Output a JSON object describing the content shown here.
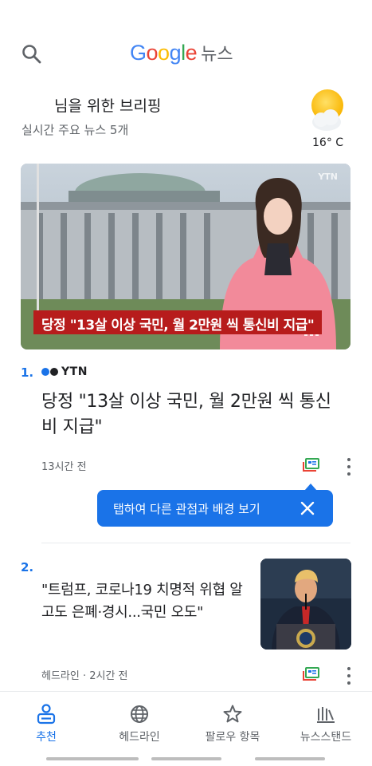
{
  "header": {
    "logo_letters": [
      {
        "char": "G",
        "color": "#4285F4"
      },
      {
        "char": "o",
        "color": "#EA4335"
      },
      {
        "char": "o",
        "color": "#FBBC05"
      },
      {
        "char": "g",
        "color": "#4285F4"
      },
      {
        "char": "l",
        "color": "#34A853"
      },
      {
        "char": "e",
        "color": "#EA4335"
      }
    ],
    "logo_suffix": "뉴스",
    "search_icon": "search-icon"
  },
  "briefing": {
    "title": "님을 위한 브리핑",
    "subtitle": "실시간 주요 뉴스 5개"
  },
  "weather": {
    "icon": "partly-cloudy-icon",
    "temperature": "16° C"
  },
  "articles": [
    {
      "number": "1.",
      "source": "YTN",
      "source_dot_colors": [
        "#1a73e8",
        "#202124"
      ],
      "image_caption": "당정 \"13살 이상 국민, 월 2만원 씩 통신비 지급\"",
      "image_watermark": "YTN",
      "headline": "당정 \"13살 이상 국민, 월 2만원 씩 통신비 지급\"",
      "time": "13시간 전"
    },
    {
      "number": "2.",
      "headline": "\"트럼프, 코로나19 치명적 위협 알고도 은폐·경시...국민 오도\"",
      "meta": "헤드라인 · 2시간 전"
    }
  ],
  "tooltip": {
    "text": "탭하여 다른 관점과 배경 보기",
    "close_icon": "close-icon"
  },
  "bottom_nav": [
    {
      "label": "추천",
      "icon": "for-you-icon",
      "active": true
    },
    {
      "label": "헤드라인",
      "icon": "globe-icon",
      "active": false
    },
    {
      "label": "팔로우 항목",
      "icon": "star-icon",
      "active": false
    },
    {
      "label": "뉴스스탠드",
      "icon": "newsstand-icon",
      "active": false
    }
  ],
  "colors": {
    "accent": "#1a73e8",
    "text_primary": "#202124",
    "text_secondary": "#5f6368",
    "caption_red": "#b71c1c"
  }
}
